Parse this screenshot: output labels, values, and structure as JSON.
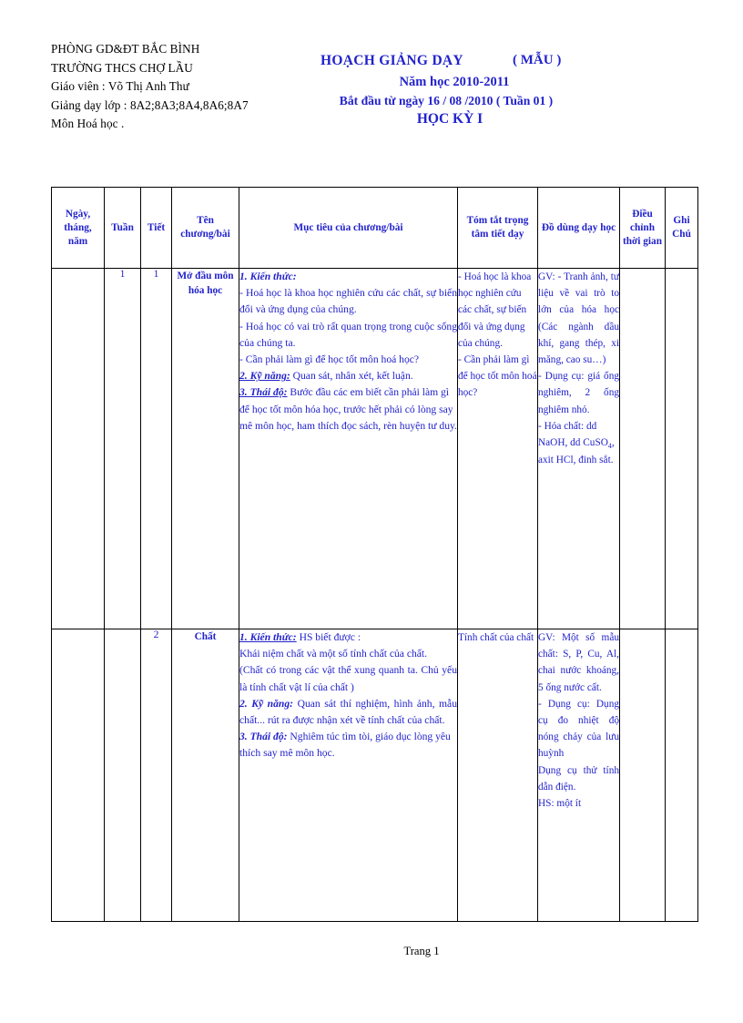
{
  "header": {
    "school_lines": [
      "PHÒNG GD&ĐT  BẮC BÌNH",
      "TRƯỜNG THCS CHỢ LẦU",
      "Giáo viên : Võ Thị Anh Thư",
      "Giảng dạy lớp : 8A2;8A3;8A4,8A6;8A7",
      "Môn Hoá học ."
    ],
    "title_main": "HOẠCH GIẢNG DẠY",
    "title_mau": "( MẪU )",
    "title_year": "Năm học 2010-2011",
    "title_start": "Bắt đầu từ ngày  16 / 08 /2010 ( Tuần 01 )",
    "title_semester": "HỌC KỲ I",
    "title_color": "#2222cc"
  },
  "table": {
    "columns": [
      {
        "key": "date",
        "label": "Ngày, tháng, năm"
      },
      {
        "key": "week",
        "label": "Tuần"
      },
      {
        "key": "period",
        "label": "Tiết"
      },
      {
        "key": "name",
        "label": "Tên chương/bài"
      },
      {
        "key": "goal",
        "label": "Mục tiêu của chương/bài"
      },
      {
        "key": "sum",
        "label": "Tóm tắt trọng tâm tiết dạy"
      },
      {
        "key": "tools",
        "label": "Đồ dùng dạy học"
      },
      {
        "key": "adjust",
        "label": "Điều chỉnh thời gian"
      },
      {
        "key": "note",
        "label": "Ghi Chú"
      }
    ],
    "rows": [
      {
        "date": "",
        "week": "1",
        "period": "1",
        "name": "Mở đầu môn hóa học",
        "goal": {
          "p1_label": "1. Kiến thức:",
          "p1_text": "",
          "p2": "- Hoá học là khoa học nghiên cứu các chất, sự biến đổi và ứng dụng của chúng.",
          "p3": "- Hoá học có vai trò rất quan trọng trong cuộc sống của chúng ta.",
          "p4": "- Cần phải làm gì để học tốt môn hoá học?",
          "p5_label": "2. Kỹ năng:",
          "p5_text": " Quan sát, nhân xét, kết luận.",
          "p6_label": "3. Thái độ:",
          "p6_text": " Bước đầu các em biết cần phải làm gì để học tốt môn hóa học, trước hết phải có lòng say mê môn học, ham thích đọc sách, rèn huyện tư duy."
        },
        "sum": "- Hoá học là khoa học nghiên cứu các chất, sự biến đổi và ứng dụng của chúng.\n- Cần phải làm gì để học tốt môn hoá học?",
        "tools_p1": "GV: - Tranh ảnh, tư liệu về vai trò to lớn của hóa học (Các ngành dầu khí, gang thép, xi măng, cao su…)",
        "tools_p2": " - Dụng cụ: giá ống nghiêm, 2 ống nghiêm nhỏ.",
        "tools_p3a": " - Hóa chất: dd NaOH,        dd CuSO",
        "tools_p3sub": "4",
        "tools_p3b": ",        axit HCl, đinh sắt.",
        "adjust": "",
        "note": ""
      },
      {
        "date": "",
        "week": "",
        "period": "2",
        "name": "Chất",
        "goal": {
          "p1_label": "1. Kiến thức:",
          "p1_text": " HS biết được :",
          "p2": "Khái niệm chất và một số tính chất của chất.",
          "p3": "(Chất có trong các vật thể xung quanh ta. Chủ yếu là tính chất vật lí của chất )",
          "p4": "",
          "p5_label": "2. Kỹ năng:",
          "p5_text": " Quan sát thí nghiệm, hình ảnh, mẫu chất... rút ra được nhận xét về tính chất của chất.",
          "p6_label": "3. Thái độ:",
          "p6_text": " Nghiêm túc tìm tòi, giáo dục lòng yêu thích say mê môn học."
        },
        "sum": "Tính chất của chất",
        "tools_p1": "GV: Một số mẫu chất: S, P, Cu, Al, chai nước khoáng, 5 ống nước cất.",
        "tools_p2": " - Dụng cụ: Dụng cụ đo nhiệt độ nóng chảy của lưu huỳnh",
        "tools_p3a": " Dụng cụ thử tính dẫn điện.",
        "tools_p3sub": "",
        "tools_p3b": "",
        "tools_p4": "HS: một ít",
        "adjust": "",
        "note": ""
      }
    ]
  },
  "footer": {
    "page_label": "Trang 1"
  }
}
